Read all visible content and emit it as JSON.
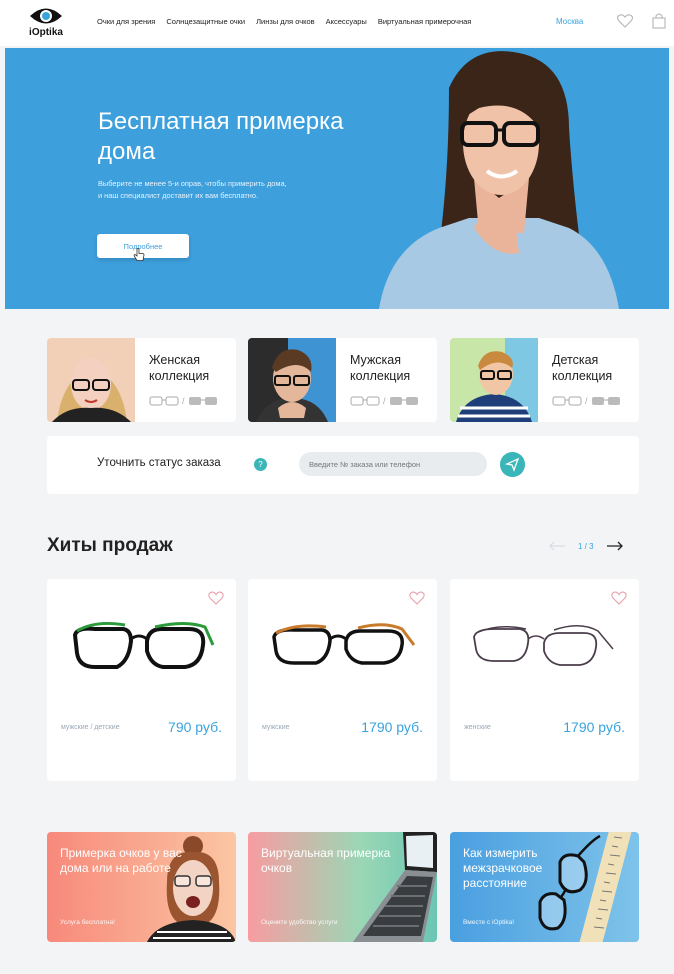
{
  "header": {
    "logo_text": "iOptika",
    "nav": [
      "Очки для зрения",
      "Солнцезащитные очки",
      "Линзы для очков",
      "Аксессуары",
      "Виртуальная примерочная"
    ],
    "city": "Москва",
    "accent_color": "#3aa3de"
  },
  "hero": {
    "title": "Бесплатная примерка дома",
    "subtitle_line1": "Выберите не менее 5-и оправ, чтобы примерить дома,",
    "subtitle_line2": "и наш специалист доставит их вам  бесплатно.",
    "button": "Подробнее",
    "background": "#3d9fdc"
  },
  "collections": [
    {
      "title": "Женская коллекция"
    },
    {
      "title": "Мужская коллекция"
    },
    {
      "title": "Детская коллекция"
    }
  ],
  "order_status": {
    "label": "Уточнить статус заказа",
    "help": "?",
    "placeholder": "Введите № заказа или телефон"
  },
  "bestsellers": {
    "title": "Хиты продаж",
    "page_current": "1",
    "page_total": "3",
    "page_text": "1 / 3",
    "products": [
      {
        "category": "мужские / детские",
        "price": "790 руб."
      },
      {
        "category": "мужские",
        "price": "1790 руб."
      },
      {
        "category": "женские",
        "price": "1790 руб."
      }
    ]
  },
  "promos": [
    {
      "title": "Примерка очков у вас дома или на работе",
      "note": "Услуга  бесплатна!"
    },
    {
      "title": "Виртуальная примерка очков",
      "note": "Оцените удобство услуги"
    },
    {
      "title": "Как измерить межзрачковое расстояние",
      "note": "Вместе с iOptika!"
    }
  ]
}
